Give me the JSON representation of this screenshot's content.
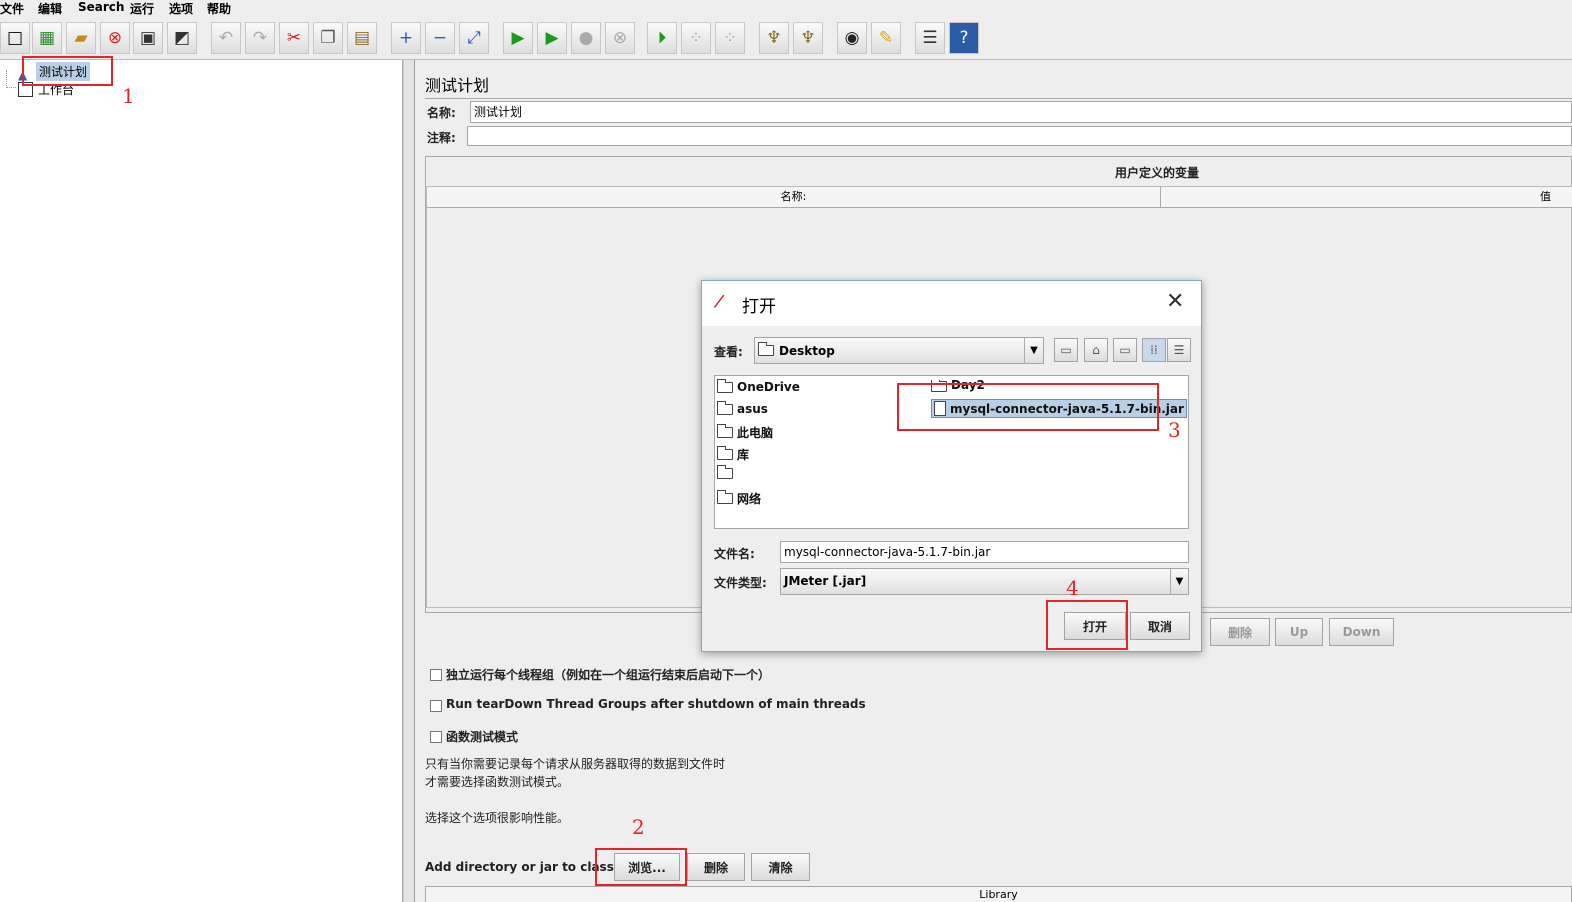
{
  "menu": [
    "文件",
    "编辑",
    "Search",
    "运行",
    "选项",
    "帮助"
  ],
  "toolbar_icons": [
    "new-icon",
    "template-icon",
    "open-icon",
    "close-icon",
    "save-icon",
    "save-as-icon",
    "undo-icon",
    "redo-icon",
    "cut-icon",
    "copy-icon",
    "paste-icon",
    "expand-icon",
    "collapse-icon",
    "toggle-icon",
    "start-icon",
    "start-no-pause-icon",
    "stop-icon",
    "shutdown-icon",
    "remote-start-icon",
    "remote-stop-icon",
    "remote-shutdown-icon",
    "clear-icon",
    "clear-all-icon",
    "search-icon",
    "reset-search-icon",
    "function-helper-icon",
    "help-icon"
  ],
  "tree": {
    "items": [
      "测试计划",
      "工作台"
    ]
  },
  "main": {
    "title": "测试计划",
    "name_label": "名称:",
    "name_value": "测试计划",
    "comment_label": "注释:",
    "vars_title": "用户定义的变量",
    "table_headers": [
      "名称:",
      "值"
    ],
    "table_buttons": [
      "删除",
      "Up",
      "Down"
    ],
    "checkboxes": [
      "独立运行每个线程组（例如在一个组运行结束后启动下一个）",
      "Run tearDown Thread Groups after shutdown of main threads",
      "函数测试模式"
    ],
    "help_lines": [
      "只有当你需要记录每个请求从服务器取得的数据到文件时",
      "才需要选择函数测试模式。",
      "选择这个选项很影响性能。"
    ],
    "classpath_label": "Add directory or jar to classpath",
    "classpath_buttons": [
      "浏览...",
      "删除",
      "清除"
    ],
    "library_header": "Library"
  },
  "dialog": {
    "title": "打开",
    "lookin_label": "查看:",
    "lookin_value": "Desktop",
    "files_left": [
      "OneDrive",
      "asus",
      "此电脑",
      "库",
      "",
      "网络"
    ],
    "files_right": [
      "Day2",
      "mysql-connector-java-5.1.7-bin.jar"
    ],
    "filename_label": "文件名:",
    "filename_value": "mysql-connector-java-5.1.7-bin.jar",
    "filetype_label": "文件类型:",
    "filetype_value": "JMeter [.jar]",
    "open_button": "打开",
    "cancel_button": "取消"
  },
  "annotations": [
    "1",
    "2",
    "3",
    "4"
  ],
  "colors": {
    "annotation": "#e0262a",
    "selection": "#b8cfe5",
    "dialog_border": "#7ea7d8"
  }
}
